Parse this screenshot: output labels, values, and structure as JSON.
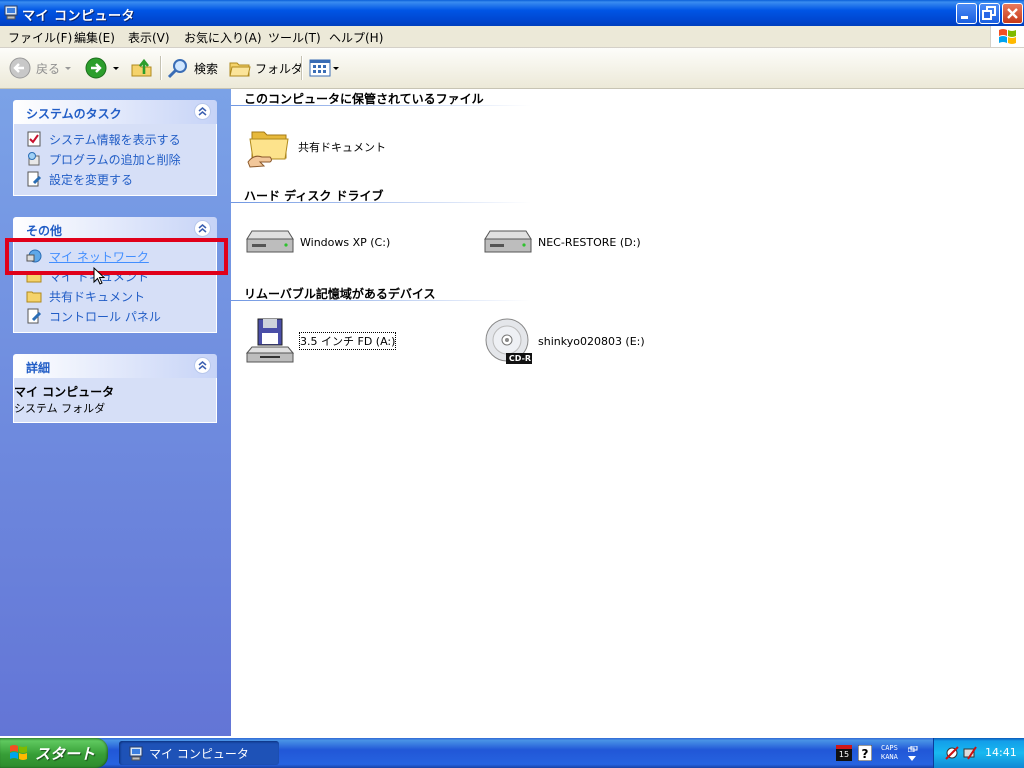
{
  "window": {
    "title": "マイ コンピュータ"
  },
  "menu": {
    "items": [
      "ファイル(F)",
      "編集(E)",
      "表示(V)",
      "お気に入り(A)",
      "ツール(T)",
      "ヘルプ(H)"
    ]
  },
  "toolbar": {
    "back_label": "戻る",
    "search_label": "検索",
    "folders_label": "フォルダ"
  },
  "taskpane": {
    "system_tasks": {
      "title": "システムのタスク",
      "links": [
        "システム情報を表示する",
        "プログラムの追加と削除",
        "設定を変更する"
      ]
    },
    "other_places": {
      "title": "その他",
      "links": [
        "マイ ネットワーク",
        "マイ ドキュメント",
        "共有ドキュメント",
        "コントロール パネル"
      ]
    },
    "details": {
      "title": "詳細",
      "name": "マイ コンピュータ",
      "type": "システム フォルダ"
    }
  },
  "content": {
    "groups": [
      {
        "title": "このコンピュータに保管されているファイル",
        "items": [
          {
            "label": "共有ドキュメント",
            "icon": "shared-folder-icon"
          }
        ]
      },
      {
        "title": "ハード ディスク ドライブ",
        "items": [
          {
            "label": "Windows XP (C:)",
            "icon": "hard-drive-icon"
          },
          {
            "label": "NEC-RESTORE (D:)",
            "icon": "hard-drive-icon"
          }
        ]
      },
      {
        "title": "リムーバブル記憶域があるデバイス",
        "items": [
          {
            "label": "3.5 インチ FD (A:)",
            "icon": "floppy-drive-icon"
          },
          {
            "label": "shinkyo020803 (E:)",
            "icon": "cd-drive-icon",
            "badge": "CD-R"
          }
        ]
      }
    ]
  },
  "taskbar": {
    "start_label": "スタート",
    "task_label": "マイ コンピュータ",
    "lang_line1": "CAPS",
    "lang_line2": "KANA",
    "ime_day": "15",
    "clock": "14:41"
  },
  "colors": {
    "titlebar": "#0055e5",
    "taskpane": "#6f8ee0",
    "link": "#215dc6",
    "highlight": "#e0001a"
  }
}
